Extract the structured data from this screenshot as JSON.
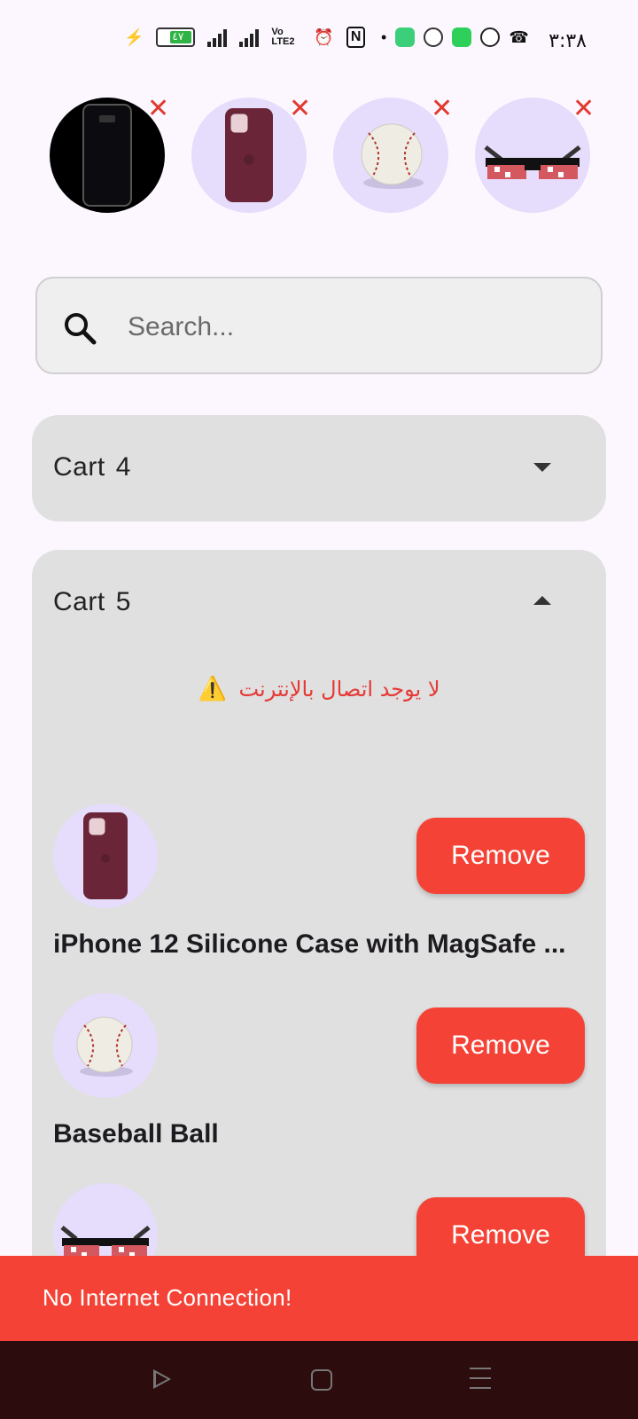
{
  "status_bar": {
    "time": "٣:٣٨",
    "battery_level": "٤٧",
    "network_label": "Vo LTE2",
    "accent_battery": "#2fb344"
  },
  "thumbnails": [
    {
      "name": "phone",
      "icon": "phone-icon",
      "remove_glyph": "✕"
    },
    {
      "name": "case",
      "icon": "phone-case-icon",
      "remove_glyph": "✕"
    },
    {
      "name": "baseball",
      "icon": "baseball-icon",
      "remove_glyph": "✕"
    },
    {
      "name": "glasses",
      "icon": "glasses-icon",
      "remove_glyph": "✕"
    }
  ],
  "search": {
    "placeholder": "Search..."
  },
  "carts": [
    {
      "label": "Cart",
      "number": "4",
      "expanded": false
    },
    {
      "label": "Cart",
      "number": "5",
      "expanded": true
    }
  ],
  "offline_message": "لا يوجد اتصال بالإنترنت",
  "cart5_items": [
    {
      "name": "iPhone 12 Silicone Case with MagSafe ...",
      "button": "Remove",
      "icon": "phone-case-icon"
    },
    {
      "name": "Baseball Ball",
      "button": "Remove",
      "icon": "baseball-icon"
    },
    {
      "name": "",
      "button": "Remove",
      "icon": "glasses-icon"
    }
  ],
  "snackbar": {
    "text": "No Internet Connection!",
    "color": "#f44336"
  },
  "colors": {
    "remove_button": "#f44336",
    "avatar_bg": "#e6dcfb",
    "cart_panel": "#e0e0e0",
    "background": "#fcf7ff",
    "navbar": "#2c0c0d"
  }
}
